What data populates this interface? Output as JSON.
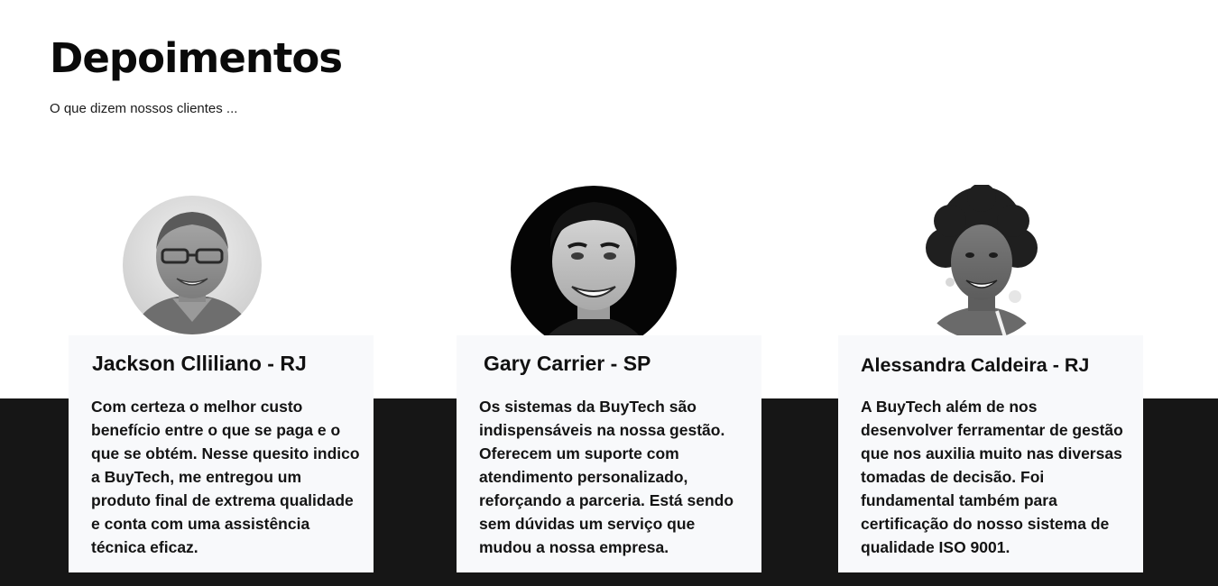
{
  "header": {
    "title": "Depoimentos",
    "subtitle": "O que dizem nossos clientes ..."
  },
  "testimonials": [
    {
      "name": "Jackson Clliliano",
      "region": " - RJ",
      "text": "Com certeza o melhor custo benefício entre o que se paga e o que se obtém. Nesse quesito indico a BuyTech, me entregou um produto final de extrema qualidade e conta com uma assistência técnica eficaz.",
      "avatar": "male-glasses-photo"
    },
    {
      "name": "Gary Carrier",
      "region": " - SP",
      "text": "Os sistemas da BuyTech são indispensáveis na nossa gestão. Oferecem um suporte com atendimento personalizado, reforçando a parceria. Está sendo sem dúvidas um serviço que mudou a nossa empresa.",
      "avatar": "male-smiling-photo"
    },
    {
      "name": "Alessandra Caldeira",
      "region": " - RJ",
      "text": "A BuyTech além de nos desenvolver ferramentar de gestão que nos auxilia muito nas diversas tomadas de decisão. Foi fundamental também para certificação do nosso sistema de qualidade ISO 9001.",
      "avatar": "female-curly-hair-photo"
    }
  ],
  "colors": {
    "band": "#161616",
    "card": "#f8f9fb",
    "text": "#111111"
  }
}
